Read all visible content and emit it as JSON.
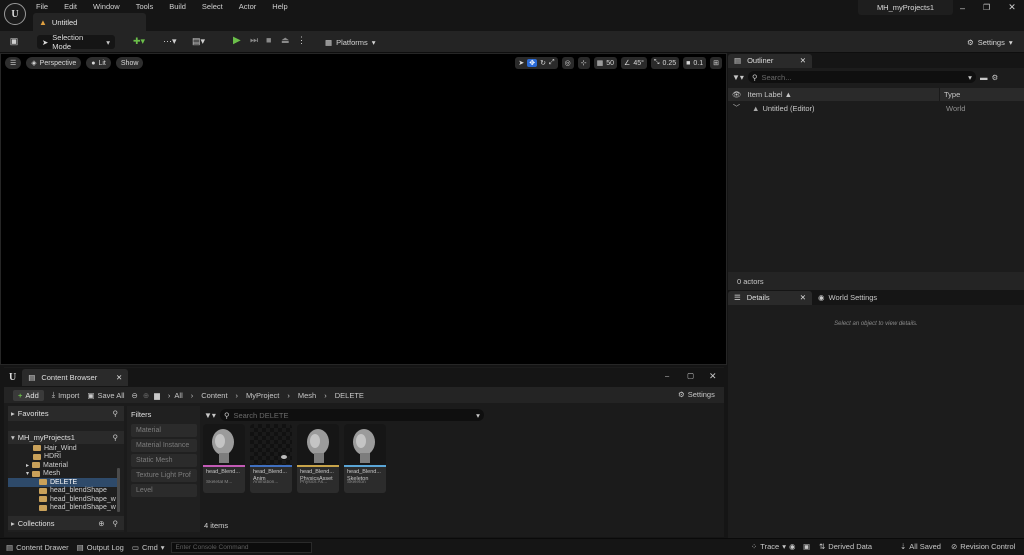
{
  "menu": [
    "File",
    "Edit",
    "Window",
    "Tools",
    "Build",
    "Select",
    "Actor",
    "Help"
  ],
  "doc_tab": "Untitled",
  "project_name": "MH_myProjects1",
  "toolbar": {
    "selection_mode": "Selection Mode",
    "platforms": "Platforms",
    "settings": "Settings"
  },
  "viewport": {
    "perspective": "Perspective",
    "lit": "Lit",
    "show": "Show",
    "grid_snap": "50",
    "rot_snap": "45°",
    "scale_snap": "0.25",
    "cam_speed": "0.1"
  },
  "outliner": {
    "tab": "Outliner",
    "search_placeholder": "Search...",
    "col_label": "Item Label ▲",
    "col_type": "Type",
    "row_label": "Untitled (Editor)",
    "row_type": "World",
    "footer": "0 actors"
  },
  "details": {
    "tab": "Details",
    "world_tab": "World Settings",
    "empty_msg": "Select an object to view details."
  },
  "content_browser": {
    "tab": "Content Browser",
    "add": "Add",
    "import": "Import",
    "save_all": "Save All",
    "breadcrumb": [
      "All",
      "Content",
      "MyProject",
      "Mesh",
      "DELETE"
    ],
    "settings": "Settings",
    "favorites": "Favorites",
    "root": "MH_myProjects1",
    "tree": [
      "Hair_Wind",
      "HDRI",
      "Material",
      "Mesh",
      "DELETE",
      "head_blendShape",
      "head_blendShape_w",
      "head_blendShape_w"
    ],
    "collections": "Collections",
    "filters_label": "Filters",
    "filters": [
      "Material",
      "Material Instance",
      "Static Mesh",
      "Texture Light Prof",
      "Level"
    ],
    "search_placeholder": "Search DELETE",
    "assets": [
      {
        "name": "head_Blend...",
        "type": "Skeletal M...",
        "color": "#c25ab5"
      },
      {
        "name": "head_Blend... Anim",
        "type": "Animation...",
        "color": "#3f6fbf"
      },
      {
        "name": "head_Blend... PhysicsAsset",
        "type": "Physics As...",
        "color": "#c8a44a"
      },
      {
        "name": "head_Blend... Skeleton",
        "type": "Skeleton",
        "color": "#5aa5d6"
      }
    ],
    "count": "4 items"
  },
  "status": {
    "drawer": "Content Drawer",
    "output": "Output Log",
    "cmd": "Cmd",
    "console_placeholder": "Enter Console Command",
    "trace": "Trace",
    "derived": "Derived Data",
    "saved": "All Saved",
    "revision": "Revision Control"
  }
}
